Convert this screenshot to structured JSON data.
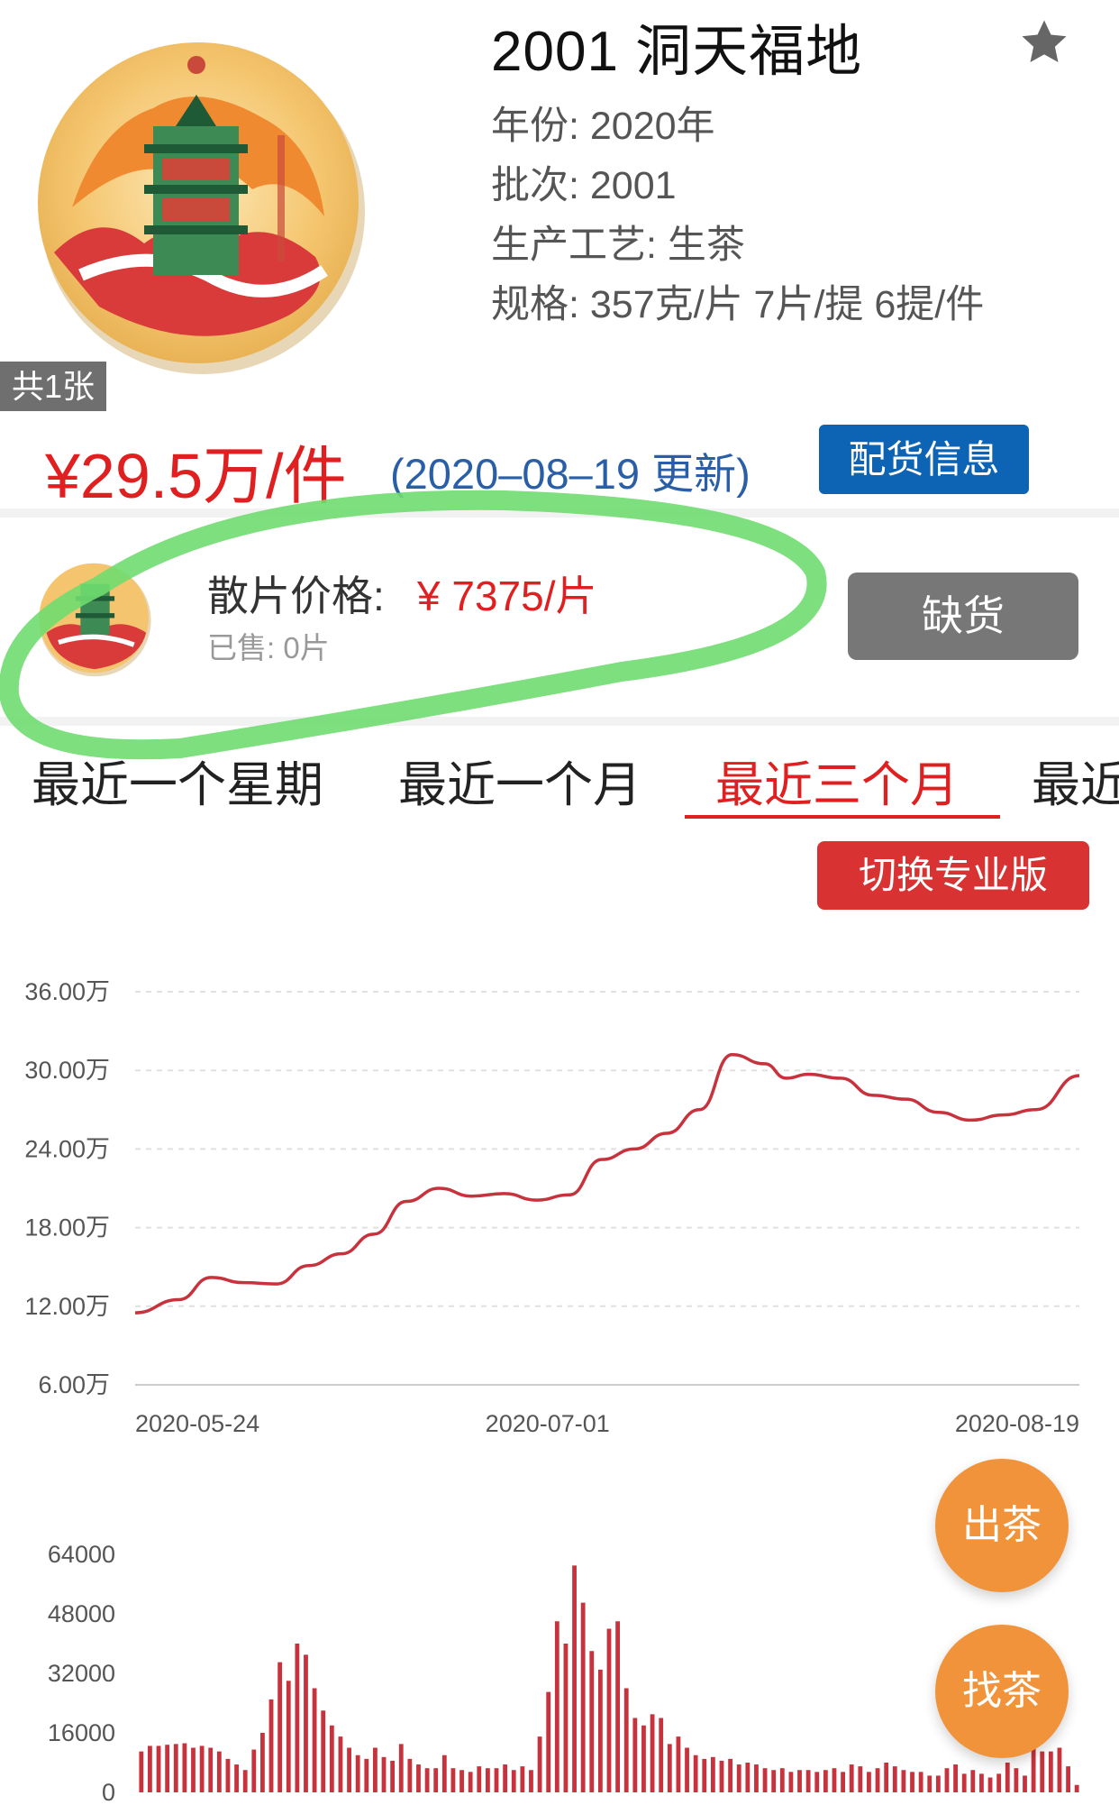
{
  "header": {
    "title": "2001 洞天福地",
    "image_count": "共1张",
    "specs": {
      "year": "年份: 2020年",
      "batch": "批次: 2001",
      "process": "生产工艺: 生茶",
      "size": "规格: 357克/片 7片/提 6提/件"
    },
    "price": "¥29.5万/件",
    "price_date": "(2020–08–19 更新)",
    "distribution_button": "配货信息"
  },
  "slice": {
    "label": "散片价格:",
    "price": "¥ 7375/片",
    "sold": "已售: 0片",
    "stock_button": "缺货"
  },
  "tabs": [
    {
      "label": "最近一个星期"
    },
    {
      "label": "最近一个月"
    },
    {
      "label": "最近三个月",
      "active": true
    },
    {
      "label": "最近"
    }
  ],
  "pro_button": "切换专业版",
  "float_buttons": {
    "sell": "出茶",
    "find": "找茶"
  },
  "colors": {
    "accent_red": "#e02020",
    "blue": "#0d63b4",
    "orange": "#f0933a",
    "highlight_green": "#6fdc6f"
  },
  "chart_data": [
    {
      "type": "line",
      "y_ticks": [
        "36.00万",
        "30.00万",
        "24.00万",
        "18.00万",
        "12.00万",
        "6.00万"
      ],
      "ylim": [
        6,
        36
      ],
      "x_ticks": [
        "2020-05-24",
        "2020-07-01",
        "2020-08-19"
      ],
      "grid": true,
      "series": [
        {
          "color": "#c8323c",
          "x": [
            "2020-05-24",
            "2020-05-28",
            "2020-05-31",
            "2020-06-03",
            "2020-06-06",
            "2020-06-09",
            "2020-06-12",
            "2020-06-15",
            "2020-06-18",
            "2020-06-21",
            "2020-06-24",
            "2020-06-27",
            "2020-06-30",
            "2020-07-03",
            "2020-07-06",
            "2020-07-09",
            "2020-07-12",
            "2020-07-15",
            "2020-07-18",
            "2020-07-21",
            "2020-07-23",
            "2020-07-25",
            "2020-07-28",
            "2020-07-31",
            "2020-08-03",
            "2020-08-06",
            "2020-08-09",
            "2020-08-12",
            "2020-08-15",
            "2020-08-19"
          ],
          "values": [
            11.5,
            12.5,
            14.2,
            13.8,
            13.7,
            15.1,
            16.0,
            17.5,
            20.0,
            21.0,
            20.4,
            20.6,
            20.1,
            20.5,
            23.2,
            24.0,
            25.2,
            27.0,
            31.2,
            30.5,
            29.4,
            29.7,
            29.4,
            28.1,
            27.8,
            26.8,
            26.2,
            26.6,
            27.0,
            29.6
          ]
        }
      ]
    },
    {
      "type": "bar",
      "y_ticks": [
        "64000",
        "48000",
        "32000",
        "16000",
        "0"
      ],
      "ylim": [
        0,
        64000
      ],
      "series": [
        {
          "color": "#c8323c",
          "values": [
            11000,
            12500,
            12500,
            12800,
            13000,
            13200,
            12000,
            12500,
            12000,
            11000,
            9000,
            7500,
            6000,
            11500,
            16000,
            25000,
            35000,
            30000,
            40000,
            37000,
            28000,
            22000,
            18000,
            15000,
            12000,
            10000,
            9000,
            12000,
            9500,
            8500,
            13000,
            9000,
            7500,
            6500,
            6500,
            10000,
            6500,
            6000,
            5500,
            7000,
            6500,
            6500,
            7500,
            6000,
            7000,
            6000,
            15000,
            27000,
            46000,
            40000,
            61000,
            51000,
            38000,
            33000,
            44000,
            46000,
            28000,
            20000,
            18000,
            21000,
            20000,
            13000,
            15000,
            12000,
            10000,
            9000,
            9500,
            8500,
            9000,
            7500,
            8000,
            7500,
            6500,
            6000,
            6500,
            5500,
            6000,
            6000,
            5500,
            6000,
            6500,
            5500,
            7500,
            7000,
            5500,
            6500,
            8000,
            7000,
            6000,
            5500,
            5500,
            4500,
            4500,
            6500,
            7500,
            5000,
            6000,
            5000,
            4000,
            5000,
            8000,
            6500,
            4500,
            12500,
            11000,
            11000,
            12000,
            7000,
            2000
          ]
        }
      ]
    }
  ]
}
